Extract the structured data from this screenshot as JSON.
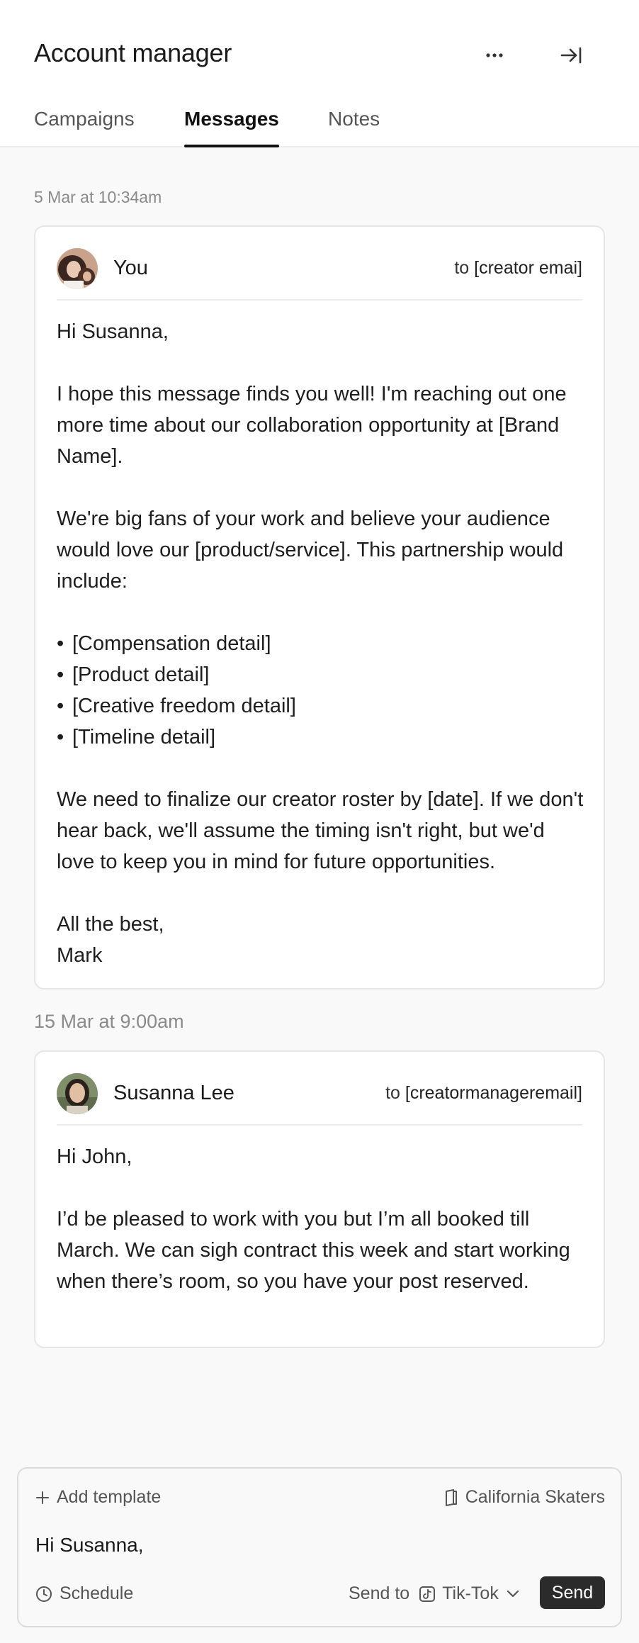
{
  "header": {
    "title": "Account manager",
    "more_icon": "ellipsis-icon",
    "collapse_icon": "collapse-right-icon",
    "tabs": [
      {
        "label": "Campaigns",
        "active": false
      },
      {
        "label": "Messages",
        "active": true
      },
      {
        "label": "Notes",
        "active": false
      }
    ]
  },
  "messages": [
    {
      "timestamp": "5 Mar at 10:34am",
      "sender": "You",
      "to_prefix": "to",
      "recipient": "[creator emai]",
      "body": {
        "greeting": "Hi Susanna,",
        "p1": "I hope this message finds you well! I'm reaching out one more time about our collaboration opportunity at [Brand Name].",
        "p2": "We're big fans of your work and believe your audience would love our [product/service]. This partnership would include:",
        "bullets": [
          "[Compensation detail]",
          "[Product detail]",
          "[Creative freedom detail]",
          "[Timeline detail]"
        ],
        "p3": "We need to finalize our creator roster by [date]. If we don't hear back, we'll assume the timing isn't right, but we'd love to keep you in mind for future opportunities.",
        "signoff": "All the best,",
        "signature": "Mark"
      }
    },
    {
      "timestamp": "15 Mar at 9:00am",
      "sender": "Susanna Lee",
      "to_prefix": "to",
      "recipient": "[creatormanageremail]",
      "body": {
        "greeting": "Hi John,",
        "p1": "I’d be pleased to work with you but I’m all booked till March. We can sigh contract this week and start working when there’s room, so you have your post reserved."
      }
    }
  ],
  "composer": {
    "add_template": "Add template",
    "brand": "California Skaters",
    "input_value": "Hi Susanna,",
    "schedule": "Schedule",
    "send_to_label": "Send to",
    "platform": "Tik-Tok",
    "send": "Send"
  },
  "colors": {
    "accent": "#111111",
    "send_button": "#2b2b2b",
    "muted_text": "#8a8a8a"
  }
}
